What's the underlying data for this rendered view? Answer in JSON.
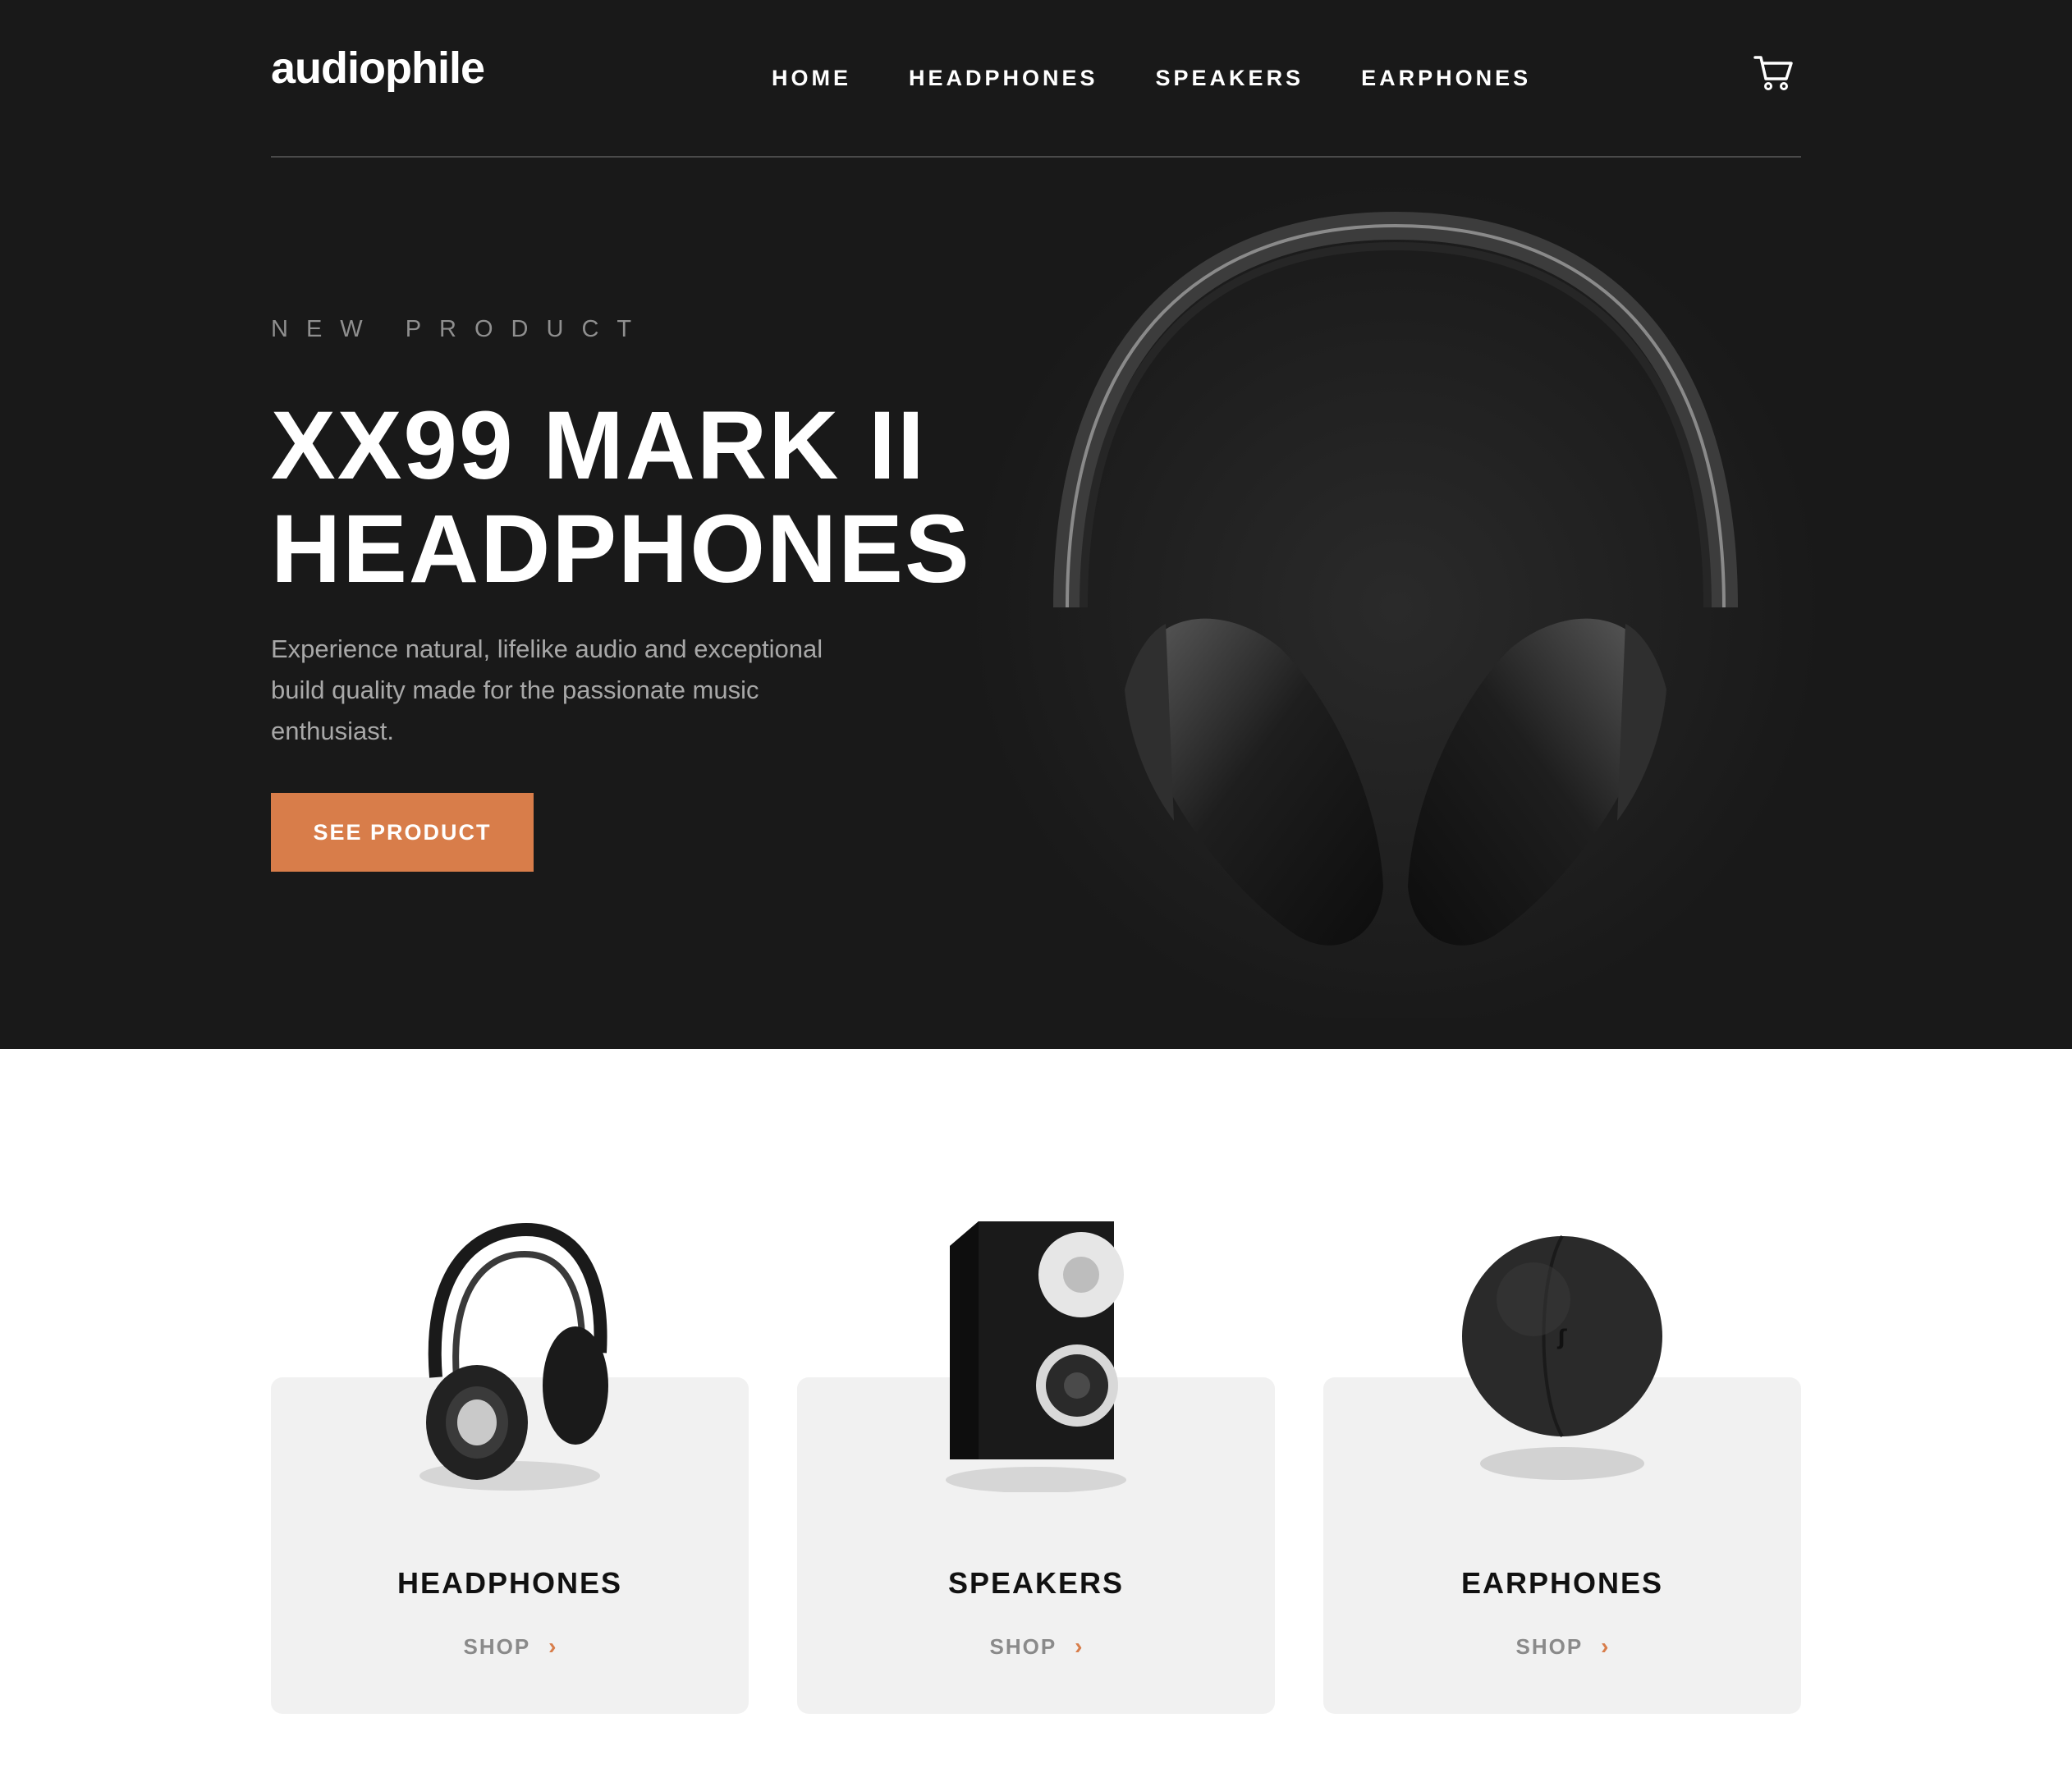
{
  "header": {
    "logo": "audiophile",
    "nav": [
      "HOME",
      "HEADPHONES",
      "SPEAKERS",
      "EARPHONES"
    ],
    "cart_icon": "cart-icon"
  },
  "hero": {
    "eyebrow": "NEW PRODUCT",
    "title_line1": "XX99 MARK II",
    "title_line2": "HEADPHONES",
    "description": "Experience natural, lifelike audio and exceptional build quality made for the passionate music enthusiast.",
    "cta": "SEE PRODUCT"
  },
  "categories": [
    {
      "title": "HEADPHONES",
      "shop": "SHOP",
      "icon": "headphones-image"
    },
    {
      "title": "SPEAKERS",
      "shop": "SHOP",
      "icon": "speaker-image"
    },
    {
      "title": "EARPHONES",
      "shop": "SHOP",
      "icon": "earphones-case-image"
    }
  ],
  "colors": {
    "hero_bg": "#191919",
    "accent": "#d87d4a",
    "card_bg": "#f1f1f1"
  }
}
